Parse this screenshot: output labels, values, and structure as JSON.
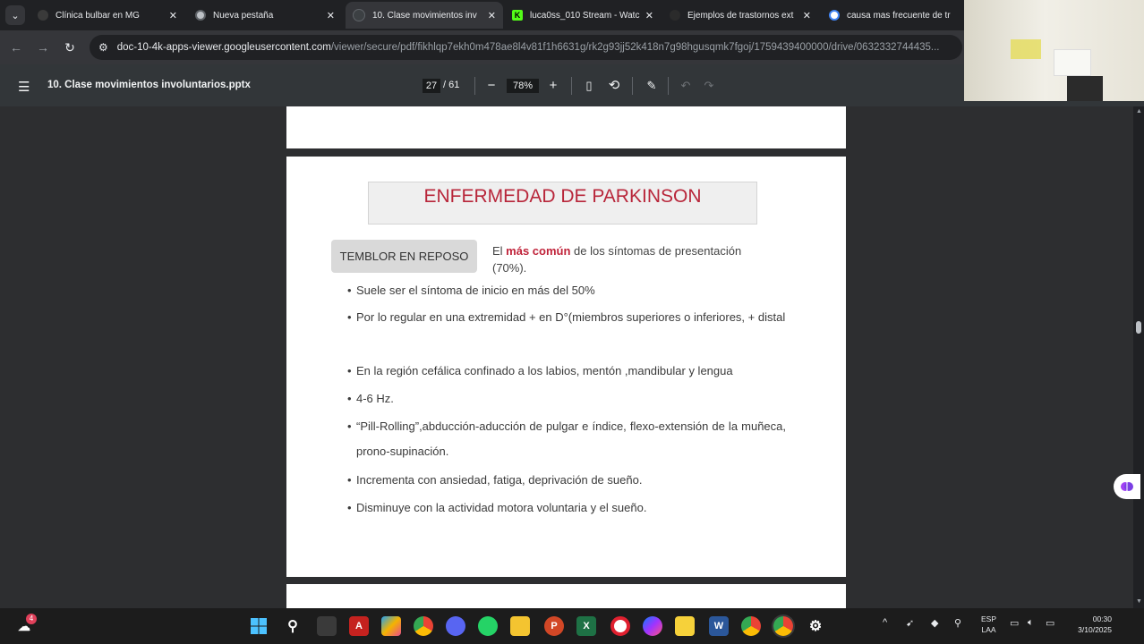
{
  "tabs": [
    {
      "title": "Clínica bulbar en MG",
      "favicon_color": "#2b2b2b",
      "active": false
    },
    {
      "title": "Nueva pestaña",
      "favicon_color": "#5f6368",
      "active": false
    },
    {
      "title": "10. Clase movimientos inv",
      "favicon_color": "#3c4043",
      "active": true
    },
    {
      "title": "luca0ss_010 Stream - Watc",
      "favicon_color": "#53fc18",
      "active": false
    },
    {
      "title": "Ejemplos de trastornos ext",
      "favicon_color": "#2b2b2b",
      "active": false
    },
    {
      "title": "causa mas frecuente de tr",
      "favicon_color": "#4285f4",
      "active": false
    }
  ],
  "tab_close_glyph": "✕",
  "kick_letter": "K",
  "address": {
    "host": "doc-10-4k-apps-viewer.googleusercontent.com",
    "path": "/viewer/secure/pdf/fikhlqp7ekh0m478ae8l4v81f1h6631g/rk2g93jj52k418n7g98hgusqmk7fgoj/1759439400000/drive/0632332744435..."
  },
  "pdf": {
    "doc_name": "10. Clase movimientos involuntarios.pptx",
    "current_page": "27",
    "total_pages": "/ 61",
    "zoom": "78%",
    "zoom_out": "−",
    "zoom_in": "+"
  },
  "slide": {
    "title": "ENFERMEDAD DE PARKINSON",
    "label": "TEMBLOR EN REPOSO",
    "intro_prefix": "El ",
    "intro_bold": "más común",
    "intro_suffix": " de los síntomas de presentación (70%).",
    "bullets": [
      "Suele ser el síntoma de inicio en más del 50%",
      "Por lo regular en una extremidad + en D°(miembros superiores o inferiores, + distal",
      "En la región cefálica confinado a los labios, mentón ,mandibular y lengua",
      "4-6 Hz.",
      "“Pill-Rolling”,abducción-aducción de pulgar e índice, flexo-extensión de la muñeca, prono-supinación.",
      " Incrementa con ansiedad, fatiga, deprivación de sueño.",
      "Disminuye con la actividad motora voluntaria y el sueño."
    ]
  },
  "taskbar": {
    "notification_count": "4",
    "language": "ESP",
    "layout": "LAA",
    "time": "00:30",
    "date": "3/10/2025"
  }
}
